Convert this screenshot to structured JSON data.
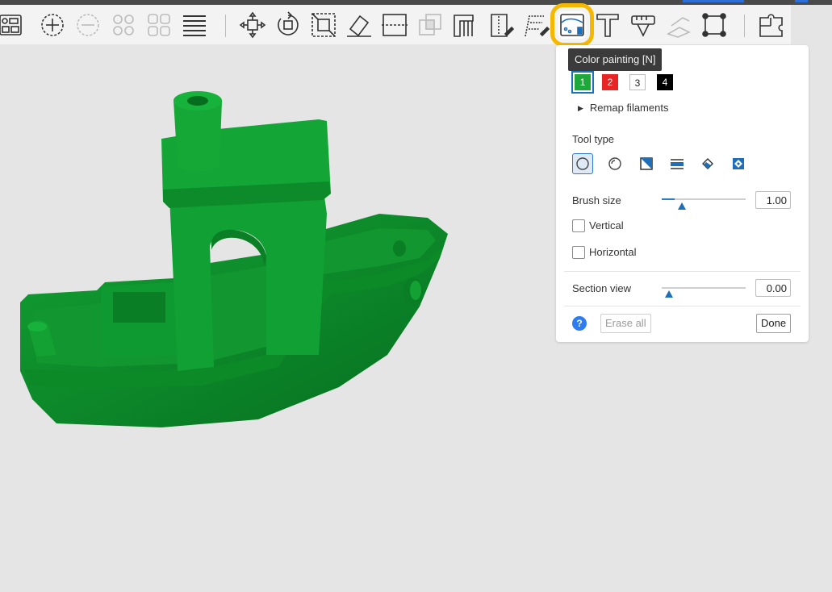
{
  "toolbar": {
    "icons": [
      "arrange-icon",
      "add-plate-icon",
      "remove-plate-icon",
      "split-objects-icon",
      "split-parts-icon",
      "layers-icon",
      "move-icon",
      "rotate-icon",
      "scale-icon",
      "lay-on-face-icon",
      "cut-icon",
      "boolean-icon",
      "support-painting-icon",
      "seam-painting-icon",
      "fuzzy-skin-icon",
      "color-painting-icon",
      "text-icon",
      "measure-icon",
      "assembly-icon",
      "bounding-box-icon",
      "puzzle-icon"
    ],
    "active_tool": "color-painting-icon"
  },
  "tooltip": {
    "text": "Color painting [N]"
  },
  "panel": {
    "filaments": [
      {
        "label": "1",
        "color": "#1fa83a"
      },
      {
        "label": "2",
        "color": "#e82424"
      },
      {
        "label": "3",
        "color": "#ffffff"
      },
      {
        "label": "4",
        "color": "#000000"
      }
    ],
    "remap_label": "Remap filaments",
    "tool_type_label": "Tool type",
    "brush_size_label": "Brush size",
    "brush_size_value": "1.00",
    "brush_size_fraction": 0.15,
    "vertical_label": "Vertical",
    "horizontal_label": "Horizontal",
    "section_view_label": "Section view",
    "section_view_value": "0.00",
    "section_view_fraction": 0.0,
    "erase_all_label": "Erase all",
    "done_label": "Done",
    "help_label": "?"
  },
  "model": {
    "name": "3D Benchy",
    "color": "#0f8a2a"
  },
  "colors": {
    "accent": "#f5b800",
    "selection": "#2f7cc4"
  }
}
